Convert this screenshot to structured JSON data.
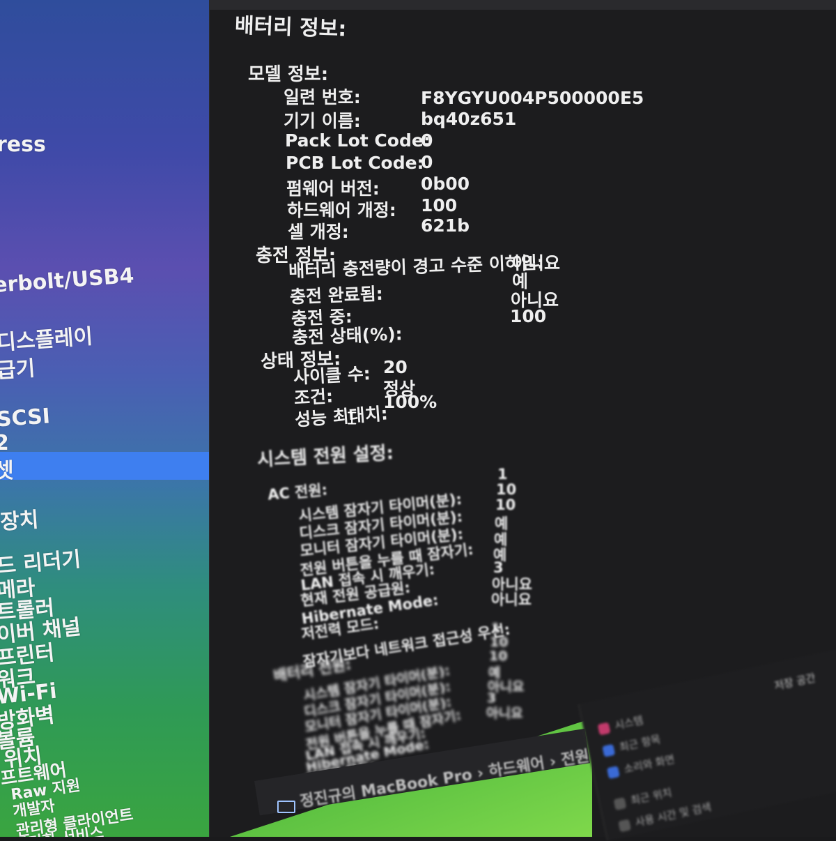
{
  "sidebar": {
    "items": [
      "ress",
      "erbolt/USB4",
      "디스플레이",
      "급기",
      "SCSI",
      "2",
      "셋",
      "장치",
      "드 리더기",
      "메라",
      "트롤러",
      "이버 채널",
      "프린터",
      "워크",
      "Wi-Fi",
      "방화벽",
      "볼륨",
      "위치",
      "프트웨어",
      "Raw 지원",
      "개발자",
      "관리형 클라이언트",
      "동기화 서비스"
    ]
  },
  "battery": {
    "title": "배터리 정보:",
    "model_title": "모델 정보:",
    "model": [
      {
        "label": "일련 번호:",
        "value": "F8YGYU004P500000E5"
      },
      {
        "label": "기기 이름:",
        "value": "bq40z651"
      },
      {
        "label": "Pack Lot Code:",
        "value": "0"
      },
      {
        "label": "PCB Lot Code:",
        "value": "0"
      },
      {
        "label": "펌웨어 버전:",
        "value": "0b00"
      },
      {
        "label": "하드웨어 개정:",
        "value": "100"
      },
      {
        "label": "셀 개정:",
        "value": "621b"
      }
    ],
    "charge_title": "충전 정보:",
    "charge": [
      {
        "label": "배터리 충전량이 경고 수준 이하임:",
        "value": "아니요"
      },
      {
        "label": "충전 완료됨:",
        "value": "예"
      },
      {
        "label": "충전 중:",
        "value": "아니요"
      },
      {
        "label": "충전 상태(%):",
        "value": "100"
      }
    ],
    "health_title": "상태 정보:",
    "health": [
      {
        "label": "사이클 수:",
        "value": "20"
      },
      {
        "label": "조건:",
        "value": "정상"
      },
      {
        "label": "성능 최대치:",
        "value": "100%"
      }
    ]
  },
  "power": {
    "title": "시스템 전원 설정:",
    "ac_title": "AC 전원:",
    "ac": [
      {
        "label": "시스템 잠자기 타이머(분):",
        "value": "1"
      },
      {
        "label": "디스크 잠자기 타이머(분):",
        "value": "10"
      },
      {
        "label": "모니터 잠자기 타이머(분):",
        "value": "10"
      },
      {
        "label": "전원 버튼을 누를 때 잠자기:",
        "value": "예"
      },
      {
        "label": "LAN 접속 시 깨우기:",
        "value": "예"
      },
      {
        "label": "현재 전원 공급원:",
        "value": "예"
      },
      {
        "label": "Hibernate Mode:",
        "value": "3"
      },
      {
        "label": "저전력 모드:",
        "value": "아니요"
      },
      {
        "label": "잠자기보다 네트워크 접근성 우선:",
        "value": "아니요"
      }
    ],
    "battery_title": "배터리 전원:",
    "battery": [
      {
        "label": "시스템 잠자기 타이머(분):",
        "value": "1"
      },
      {
        "label": "디스크 잠자기 타이머(분):",
        "value": "10"
      },
      {
        "label": "모니터 잠자기 타이머(분):",
        "value": "10"
      },
      {
        "label": "전원 버튼을 누를 때 잠자기:",
        "value": "예"
      },
      {
        "label": "LAN 접속 시 깨우기:",
        "value": "아니요"
      },
      {
        "label": "Hibernate Mode:",
        "value": "3"
      },
      {
        "label": "저전력 모드:",
        "value": "아니요"
      }
    ]
  },
  "breadcrumb": "정진규의 MacBook Pro › 하드웨어 › 전원",
  "popup": {
    "title": "저장 공간",
    "items": [
      "시스템",
      "최근 항목",
      "소리와 화면",
      "최근 위치",
      "사용 시간 및 검색"
    ]
  },
  "colors": {
    "selection": "#3e7ff0",
    "text": "#efefef",
    "bg": "#1c1c1e"
  }
}
